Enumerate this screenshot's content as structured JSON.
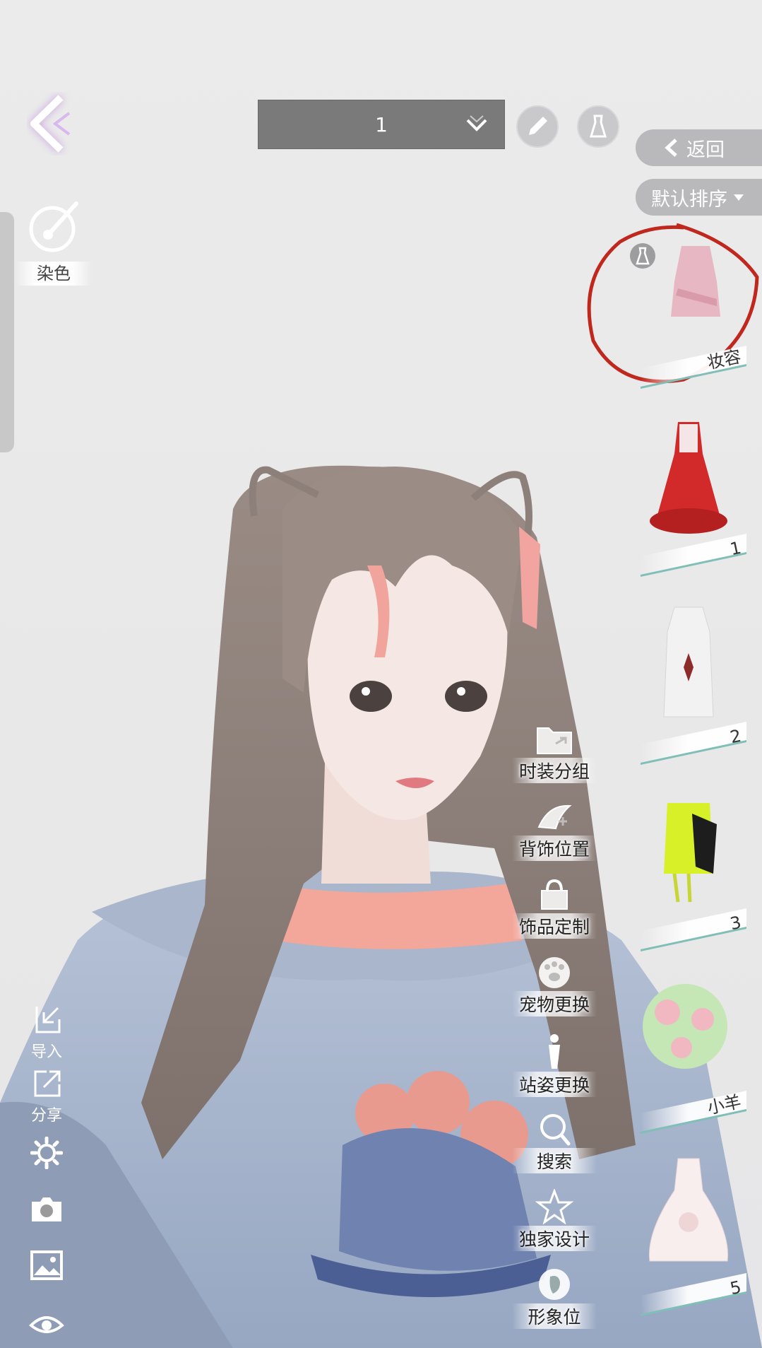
{
  "topbar": {
    "outfit_selected": "1"
  },
  "left": {
    "dye_label": "染色",
    "import_label": "导入",
    "share_label": "分享"
  },
  "right": {
    "return_label": "返回",
    "sort_label": "默认排序",
    "cards": [
      {
        "label": "妆容",
        "icon": "pink-crop-top",
        "selected": true
      },
      {
        "label": "1",
        "icon": "red-gown"
      },
      {
        "label": "2",
        "icon": "white-halter-top"
      },
      {
        "label": "3",
        "icon": "neon-jacket"
      },
      {
        "label": "小羊",
        "icon": "floral-dress"
      },
      {
        "label": "5",
        "icon": "white-frill-dress"
      }
    ]
  },
  "menu": {
    "items": [
      {
        "label": "时装分组",
        "icon": "folder-icon"
      },
      {
        "label": "背饰位置",
        "icon": "wing-move-icon"
      },
      {
        "label": "饰品定制",
        "icon": "bag-icon"
      },
      {
        "label": "宠物更换",
        "icon": "paw-icon"
      },
      {
        "label": "站姿更换",
        "icon": "person-icon"
      },
      {
        "label": "搜索",
        "icon": "search-icon"
      },
      {
        "label": "独家设计",
        "icon": "star-icon"
      },
      {
        "label": "形象位",
        "icon": "portrait-icon"
      }
    ]
  },
  "colors": {
    "accent_circle": "#c0281e",
    "pill_bg": "#b9b9bb",
    "dropdown_bg": "#7a7a7a"
  }
}
